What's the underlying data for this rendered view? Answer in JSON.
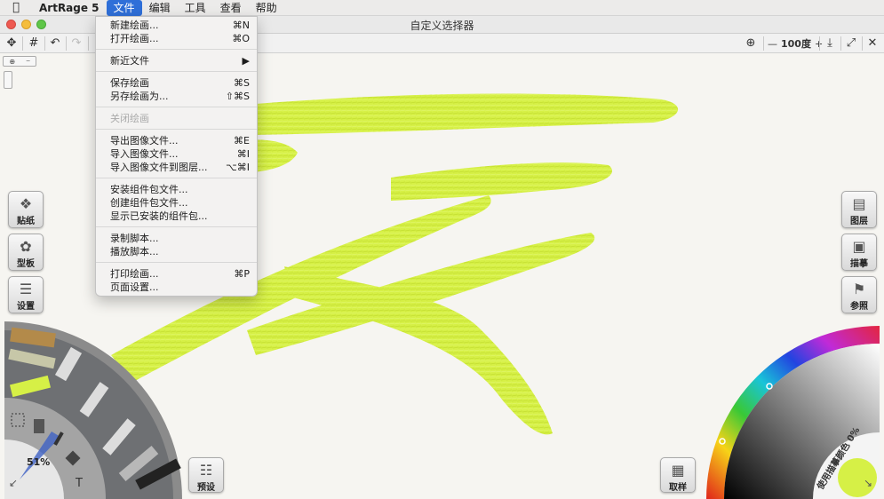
{
  "menubar": {
    "apple_icon": "apple-logo-icon",
    "app_name": "ArtRage 5",
    "items": [
      {
        "label": "文件",
        "active": true
      },
      {
        "label": "编辑"
      },
      {
        "label": "工具"
      },
      {
        "label": "查看"
      },
      {
        "label": "帮助"
      }
    ]
  },
  "window": {
    "title": "自定义选择器"
  },
  "toolbar": {
    "zoom_minus": "—",
    "zoom_value": "100度",
    "zoom_plus": "+"
  },
  "file_menu": {
    "groups": [
      [
        {
          "label": "新建绘画...",
          "shortcut": "⌘N"
        },
        {
          "label": "打开绘画...",
          "shortcut": "⌘O"
        }
      ],
      [
        {
          "label": "新近文件",
          "shortcut": "▶"
        }
      ],
      [
        {
          "label": "保存绘画",
          "shortcut": "⌘S"
        },
        {
          "label": "另存绘画为...",
          "shortcut": "⇧⌘S"
        }
      ],
      [
        {
          "label": "关闭绘画",
          "shortcut": "",
          "disabled": true
        }
      ],
      [
        {
          "label": "导出图像文件...",
          "shortcut": "⌘E"
        },
        {
          "label": "导入图像文件...",
          "shortcut": "⌘I"
        },
        {
          "label": "导入图像文件到图层...",
          "shortcut": "⌥⌘I"
        }
      ],
      [
        {
          "label": "安装组件包文件...",
          "shortcut": ""
        },
        {
          "label": "创建组件包文件...",
          "shortcut": ""
        },
        {
          "label": "显示已安装的组件包...",
          "shortcut": ""
        }
      ],
      [
        {
          "label": "录制脚本...",
          "shortcut": ""
        },
        {
          "label": "播放脚本...",
          "shortcut": ""
        }
      ],
      [
        {
          "label": "打印绘画...",
          "shortcut": "⌘P"
        },
        {
          "label": "页面设置...",
          "shortcut": ""
        }
      ]
    ]
  },
  "left_panel": {
    "stickers_label": "贴纸",
    "stencils_label": "型板",
    "settings_label": "设置"
  },
  "right_panel": {
    "layers_label": "图层",
    "tracing_label": "描摹",
    "reference_label": "参照"
  },
  "tool_wheel": {
    "size_value": "51%",
    "text_tool_glyph": "T"
  },
  "presets_label": "预设",
  "sampler_label": "取样",
  "color_picker": {
    "tracing_color_text": "使用描摹颜色 0%",
    "current_color": "#d6f046"
  },
  "paint_color": "#d6f046"
}
